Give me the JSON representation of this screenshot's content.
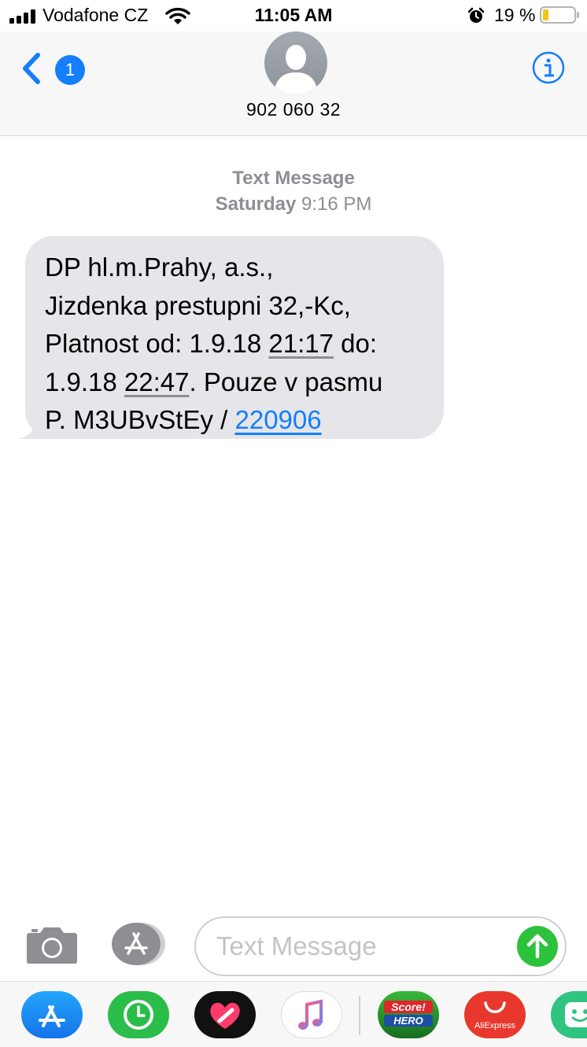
{
  "status_bar": {
    "carrier": "Vodafone CZ",
    "time": "11:05 AM",
    "battery_percent": "19 %",
    "battery_level": 0.19,
    "icons": [
      "signal-icon",
      "wifi-icon",
      "alarm-icon",
      "battery-icon"
    ]
  },
  "header": {
    "back_badge": "1",
    "contact_name": "902 060 32",
    "icons": [
      "back-chevron-icon",
      "avatar-icon",
      "info-icon"
    ]
  },
  "thread": {
    "service": "Text Message",
    "day": "Saturday",
    "time": "9:16 PM",
    "message": {
      "line1": "DP hl.m.Prahy, a.s.,",
      "line2": "Jizdenka prestupni 32,-Kc,",
      "line3_prefix": "Platnost od: 1.9.18 ",
      "line3_time": "21:17",
      "line3_suffix": " do:",
      "line4_prefix": "1.9.18 ",
      "line4_time": "22:47",
      "line4_suffix": ". Pouze v pasmu",
      "line5_prefix": "P. M3UBvStEy / ",
      "line5_link": "220906"
    }
  },
  "composer": {
    "placeholder": "Text Message",
    "icons": [
      "camera-icon",
      "app-store-icon",
      "send-icon"
    ]
  },
  "app_drawer": {
    "apps": [
      {
        "name": "App Store",
        "icon": "app-store-icon",
        "color": "#1a8cf5"
      },
      {
        "name": "Activity",
        "icon": "activity-icon",
        "color": "#2bbd4a"
      },
      {
        "name": "Digital Touch",
        "icon": "heart-icon",
        "color": "#111111"
      },
      {
        "name": "Music",
        "icon": "music-icon",
        "color": "#ffffff"
      },
      {
        "name": "Score! Hero",
        "icon": "score-hero-icon",
        "color": "#1f9a2a",
        "label_top": "Score!",
        "label_bottom": "HERO"
      },
      {
        "name": "AliExpress",
        "icon": "aliexpress-icon",
        "color": "#e8382d",
        "label": "AliExpress"
      },
      {
        "name": "Stickers",
        "icon": "sticker-icon",
        "color": "#2fc480"
      }
    ]
  },
  "colors": {
    "accent": "#147efb",
    "bubble": "#e5e5ea",
    "send": "#2cc23c",
    "meta_text": "#8e8e93"
  }
}
